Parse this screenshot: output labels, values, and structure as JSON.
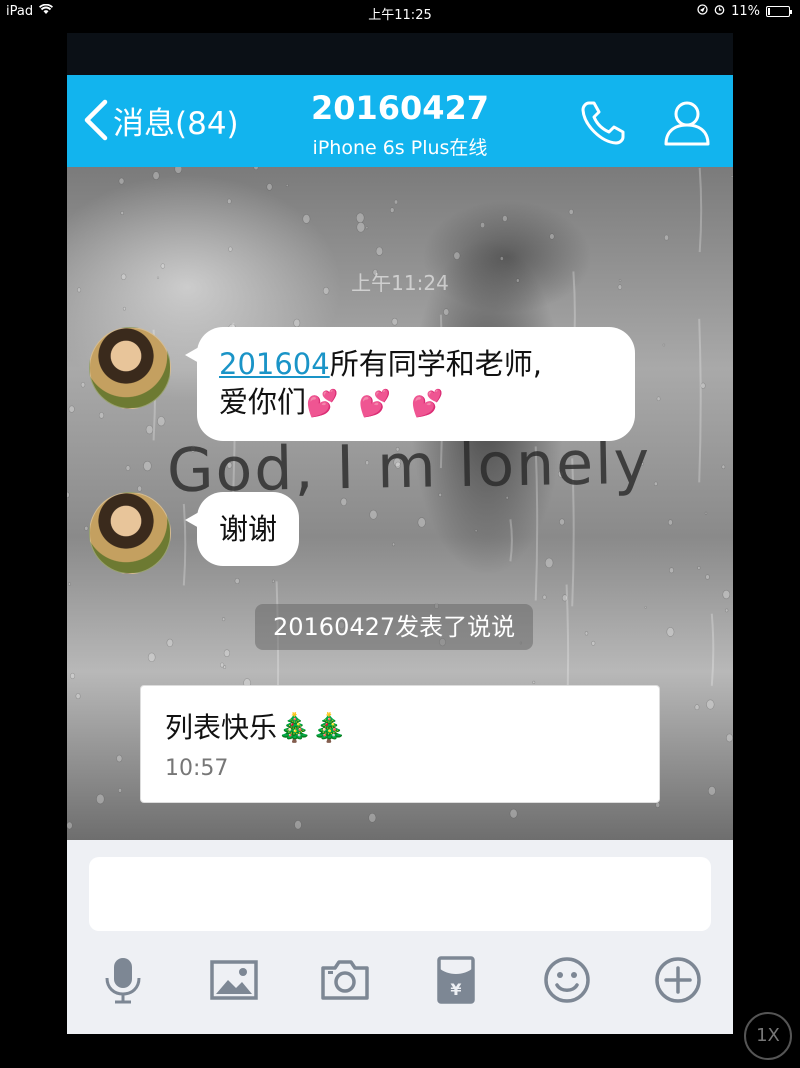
{
  "status_bar": {
    "device": "iPad",
    "time": "上午11:25",
    "battery_text": "11%",
    "battery_level": 0.11
  },
  "nav": {
    "back_label": "消息(84)",
    "title": "20160427",
    "subtitle": "iPhone 6s Plus在线",
    "phone_icon": "phone-icon",
    "profile_icon": "user-icon"
  },
  "chat": {
    "timestamp": "上午11:24",
    "background_text": "God, I m lonely",
    "messages": [
      {
        "link_text": "201604",
        "text_line1": "所有同学和老师,",
        "text_line2": "爱你们",
        "emoji": "💕 💕 💕"
      },
      {
        "text": "谢谢"
      }
    ],
    "system_notice": "20160427发表了说说",
    "post": {
      "text": "列表快乐",
      "emoji": "🎄🎄",
      "time": "10:57"
    }
  },
  "input": {
    "value": "",
    "placeholder": ""
  },
  "toolbar": {
    "icons": [
      "microphone-icon",
      "image-icon",
      "camera-icon",
      "red-packet-icon",
      "emoji-icon",
      "plus-icon"
    ]
  },
  "overlay": {
    "zoom_label": "1X"
  },
  "colors": {
    "nav_bg": "#12b4ee",
    "link": "#1a94c7",
    "toolbar_bg": "#eef0f4",
    "icon_gray": "#7d8794"
  }
}
